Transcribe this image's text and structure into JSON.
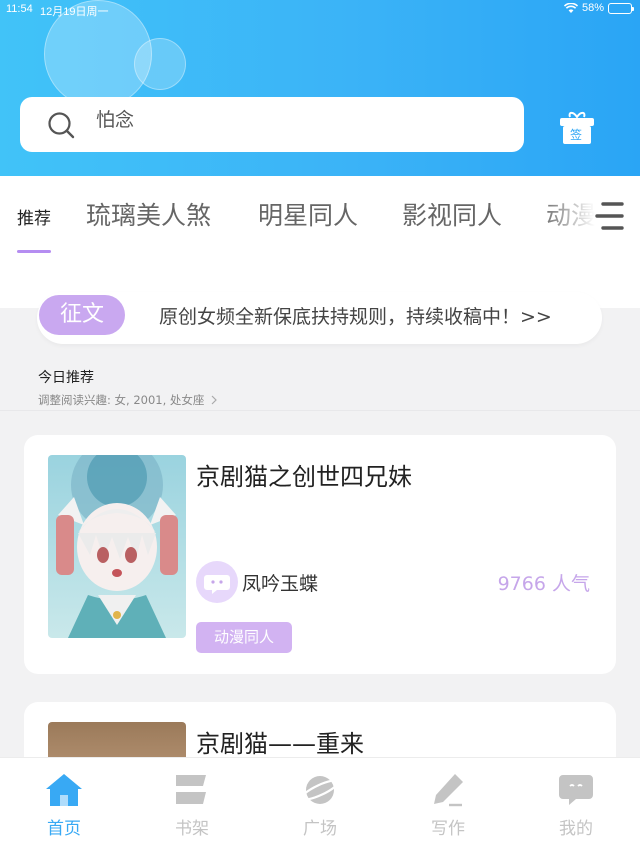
{
  "status_bar": {
    "time": "11:54",
    "date": "12月19日周一",
    "battery": "58%",
    "battery_level": 0.58
  },
  "header": {
    "search_text": "怕念",
    "search_icon": "search-icon",
    "gift_icon": "gift-sign-icon",
    "gift_label": "签",
    "gradient_start": "#41c3f8",
    "gradient_end": "#2aa5f5"
  },
  "tabs": [
    {
      "label": "推荐",
      "active": true
    },
    {
      "label": "琉璃美人煞",
      "active": false
    },
    {
      "label": "明星同人",
      "active": false
    },
    {
      "label": "影视同人",
      "active": false
    },
    {
      "label": "动漫",
      "active": false
    }
  ],
  "accent_color": "#b58df1",
  "notice": {
    "tag": "征文",
    "message": "原创女频全新保底扶持规则，持续收稿中！>>"
  },
  "today": {
    "title": "今日推荐",
    "subtitle": "调整阅读兴趣: 女, 2001, 处女座"
  },
  "books": [
    {
      "title": "京剧猫之创世四兄妹",
      "author": "凤吟玉蝶",
      "popularity": "9766 人气",
      "tag": "动漫同人"
    },
    {
      "title": "京剧猫——重来"
    }
  ],
  "bottom_nav": [
    {
      "label": "首页",
      "icon": "home-icon",
      "active": true
    },
    {
      "label": "书架",
      "icon": "bookshelf-icon",
      "active": false
    },
    {
      "label": "广场",
      "icon": "planet-icon",
      "active": false
    },
    {
      "label": "写作",
      "icon": "pen-icon",
      "active": false
    },
    {
      "label": "我的",
      "icon": "chat-bubble-icon",
      "active": false
    }
  ]
}
